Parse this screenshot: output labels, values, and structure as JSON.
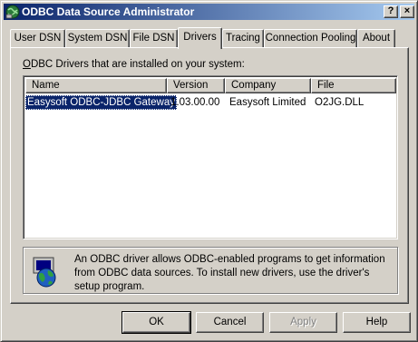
{
  "window": {
    "title": "ODBC Data Source Administrator",
    "help_glyph": "?",
    "close_glyph": "×"
  },
  "tabs": [
    {
      "label": "User DSN"
    },
    {
      "label": "System DSN"
    },
    {
      "label": "File DSN"
    },
    {
      "label": "Drivers"
    },
    {
      "label": "Tracing"
    },
    {
      "label": "Connection Pooling"
    },
    {
      "label": "About"
    }
  ],
  "active_tab": "Drivers",
  "drivers": {
    "section_label_mnemonic": "O",
    "section_label_rest": "DBC Drivers that are installed on your system:",
    "columns": [
      "Name",
      "Version",
      "Company",
      "File"
    ],
    "rows": [
      {
        "name": "Easysoft ODBC-JDBC Gateway",
        "version": "1.03.00.00",
        "company": "Easysoft Limited",
        "file": "O2JG.DLL",
        "selected": true
      }
    ]
  },
  "info": {
    "text": "An ODBC driver allows ODBC-enabled programs to get information from ODBC data sources.  To install new drivers, use the driver's setup program.",
    "icon": "globe-computer-icon"
  },
  "buttons": {
    "ok": "OK",
    "cancel": "Cancel",
    "apply": "Apply",
    "help": "Help"
  },
  "colors": {
    "selection": "#0a246a",
    "face": "#d4d0c8"
  }
}
